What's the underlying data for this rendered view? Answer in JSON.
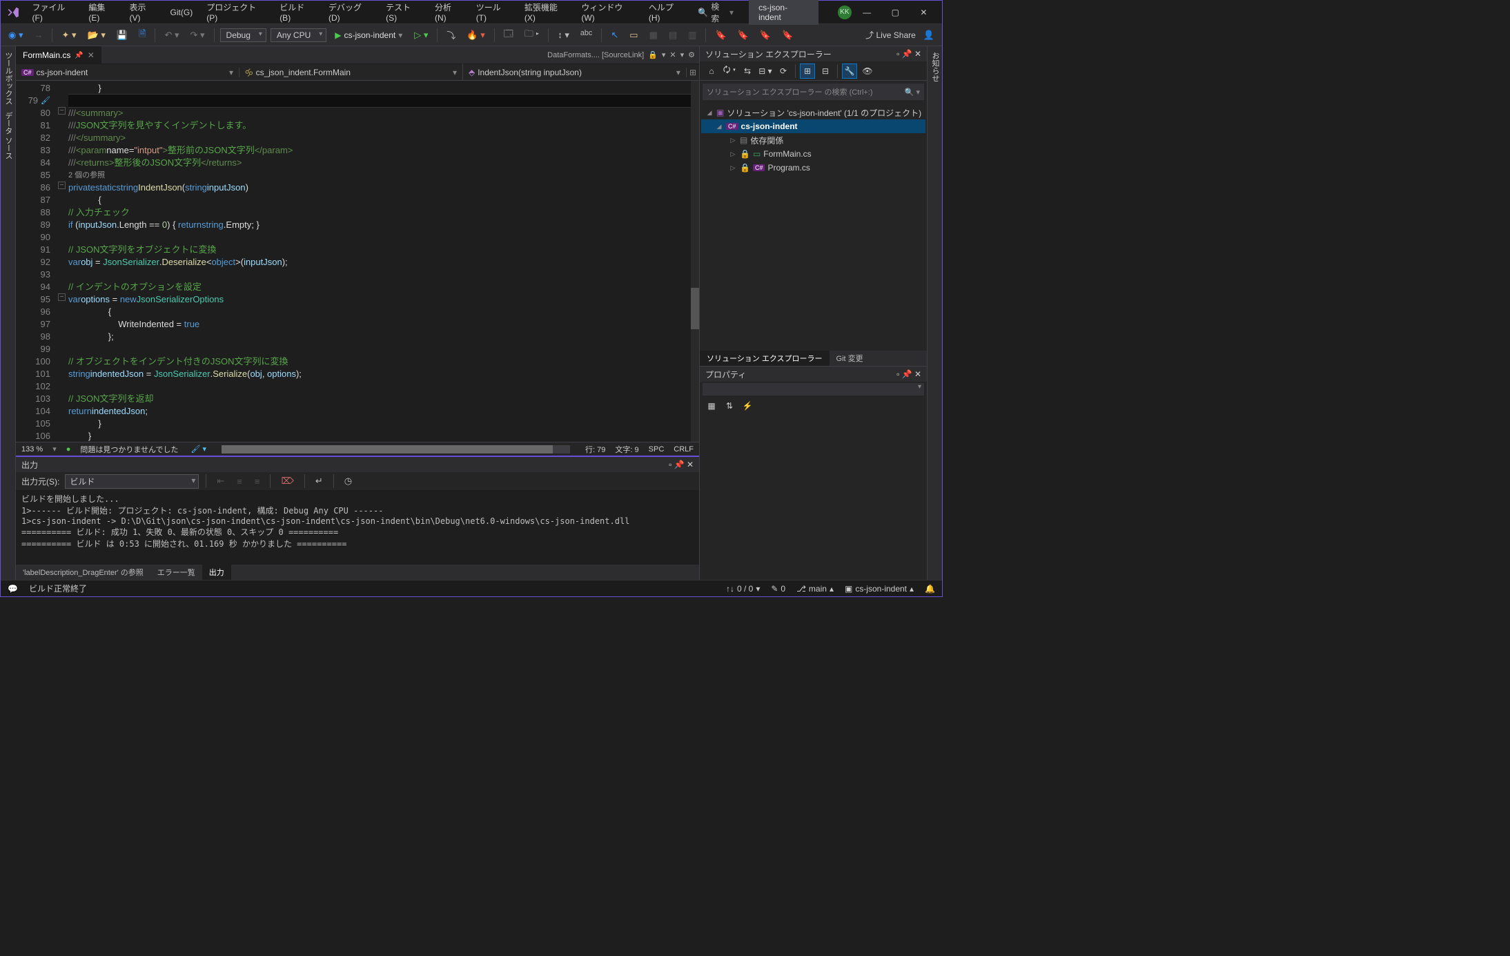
{
  "menu": [
    "ファイル(F)",
    "編集(E)",
    "表示(V)",
    "Git(G)",
    "プロジェクト(P)",
    "ビルド(B)",
    "デバッグ(D)",
    "テスト(S)",
    "分析(N)",
    "ツール(T)",
    "拡張機能(X)",
    "ウィンドウ(W)",
    "ヘルプ(H)"
  ],
  "search_placeholder": "検索",
  "title_pill": "cs-json-indent",
  "avatar": "KK",
  "toolbar": {
    "config": "Debug",
    "platform": "Any CPU",
    "run_target": "cs-json-indent",
    "live_share": "Live Share"
  },
  "left_rail": [
    "ツールボックス",
    "データ ソース"
  ],
  "right_rail": "お知らせ",
  "doc_tab": {
    "name": "FormMain.cs"
  },
  "doc_tabs_right": "DataFormats.... [SourceLink]",
  "nav": {
    "project": "cs-json-indent",
    "class": "cs_json_indent.FormMain",
    "method": "IndentJson(string inputJson)"
  },
  "code_lines": [
    78,
    79,
    80,
    81,
    82,
    83,
    84,
    85,
    86,
    87,
    88,
    89,
    90,
    91,
    92,
    93,
    94,
    95,
    96,
    97,
    98,
    99,
    100,
    101,
    102,
    103,
    104,
    105,
    106
  ],
  "codelens_ref": "2 個の参照",
  "editor_status": {
    "zoom": "133 %",
    "issues": "問題は見つかりませんでした",
    "line": "行: 79",
    "col": "文字: 9",
    "ws": "SPC",
    "eol": "CRLF"
  },
  "output": {
    "title": "出力",
    "source_label": "出力元(S):",
    "source_value": "ビルド",
    "body": "ビルドを開始しました...\n1>------ ビルド開始: プロジェクト: cs-json-indent, 構成: Debug Any CPU ------\n1>cs-json-indent -> D:\\D\\Git\\json\\cs-json-indent\\cs-json-indent\\cs-json-indent\\bin\\Debug\\net6.0-windows\\cs-json-indent.dll\n========== ビルド: 成功 1、失敗 0、最新の状態 0、スキップ 0 ==========\n========== ビルド は 0:53 に開始され、01.169 秒 かかりました ==========",
    "tabs": [
      "'labelDescription_DragEnter' の参照",
      "エラー一覧",
      "出力"
    ]
  },
  "solution": {
    "title": "ソリューション エクスプローラー",
    "search_placeholder": "ソリューション エクスプローラー の検索 (Ctrl+:)",
    "root": "ソリューション 'cs-json-indent' (1/1 のプロジェクト)",
    "project": "cs-json-indent",
    "nodes": [
      "依存関係",
      "FormMain.cs",
      "Program.cs"
    ],
    "bottom_tabs": [
      "ソリューション エクスプローラー",
      "Git 変更"
    ]
  },
  "properties": {
    "title": "プロパティ"
  },
  "statusbar": {
    "msg": "ビルド正常終了",
    "changes": "0 / 0",
    "pending": "0",
    "branch": "main",
    "repo": "cs-json-indent"
  }
}
